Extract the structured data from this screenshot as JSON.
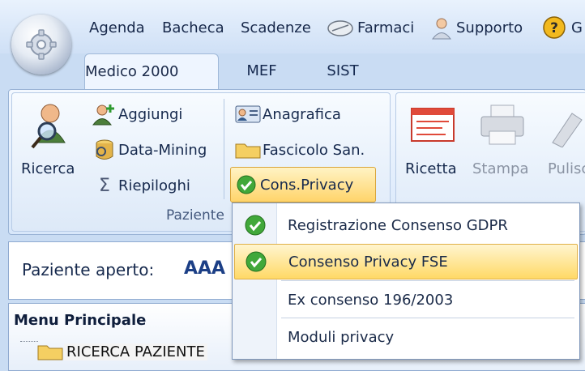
{
  "quick_access": {
    "agenda": "Agenda",
    "bacheca": "Bacheca",
    "scadenze": "Scadenze",
    "farmaci": "Farmaci",
    "supporto": "Supporto",
    "guida_partial": "G"
  },
  "tabs": {
    "medico": "Medico 2000",
    "mef": "MEF",
    "sist": "SIST"
  },
  "ribbon": {
    "ricerca": "Ricerca",
    "aggiungi": "Aggiungi",
    "data_mining": "Data-Mining",
    "riepiloghi": "Riepiloghi",
    "anagrafica": "Anagrafica",
    "fascicolo": "Fascicolo San.",
    "cons_privacy": "Cons.Privacy",
    "group_label": "Paziente",
    "ricetta": "Ricetta",
    "stampa": "Stampa",
    "pulisci_partial": "Pulisc"
  },
  "patient": {
    "label": "Paziente aperto:",
    "value_partial": "AAA"
  },
  "menu": {
    "title": "Menu Principale",
    "item_selected": "RICERCA PAZIENTE"
  },
  "dropdown": {
    "items": [
      "Registrazione Consenso GDPR",
      "Consenso Privacy FSE",
      "Ex consenso 196/2003",
      "Moduli privacy"
    ]
  }
}
